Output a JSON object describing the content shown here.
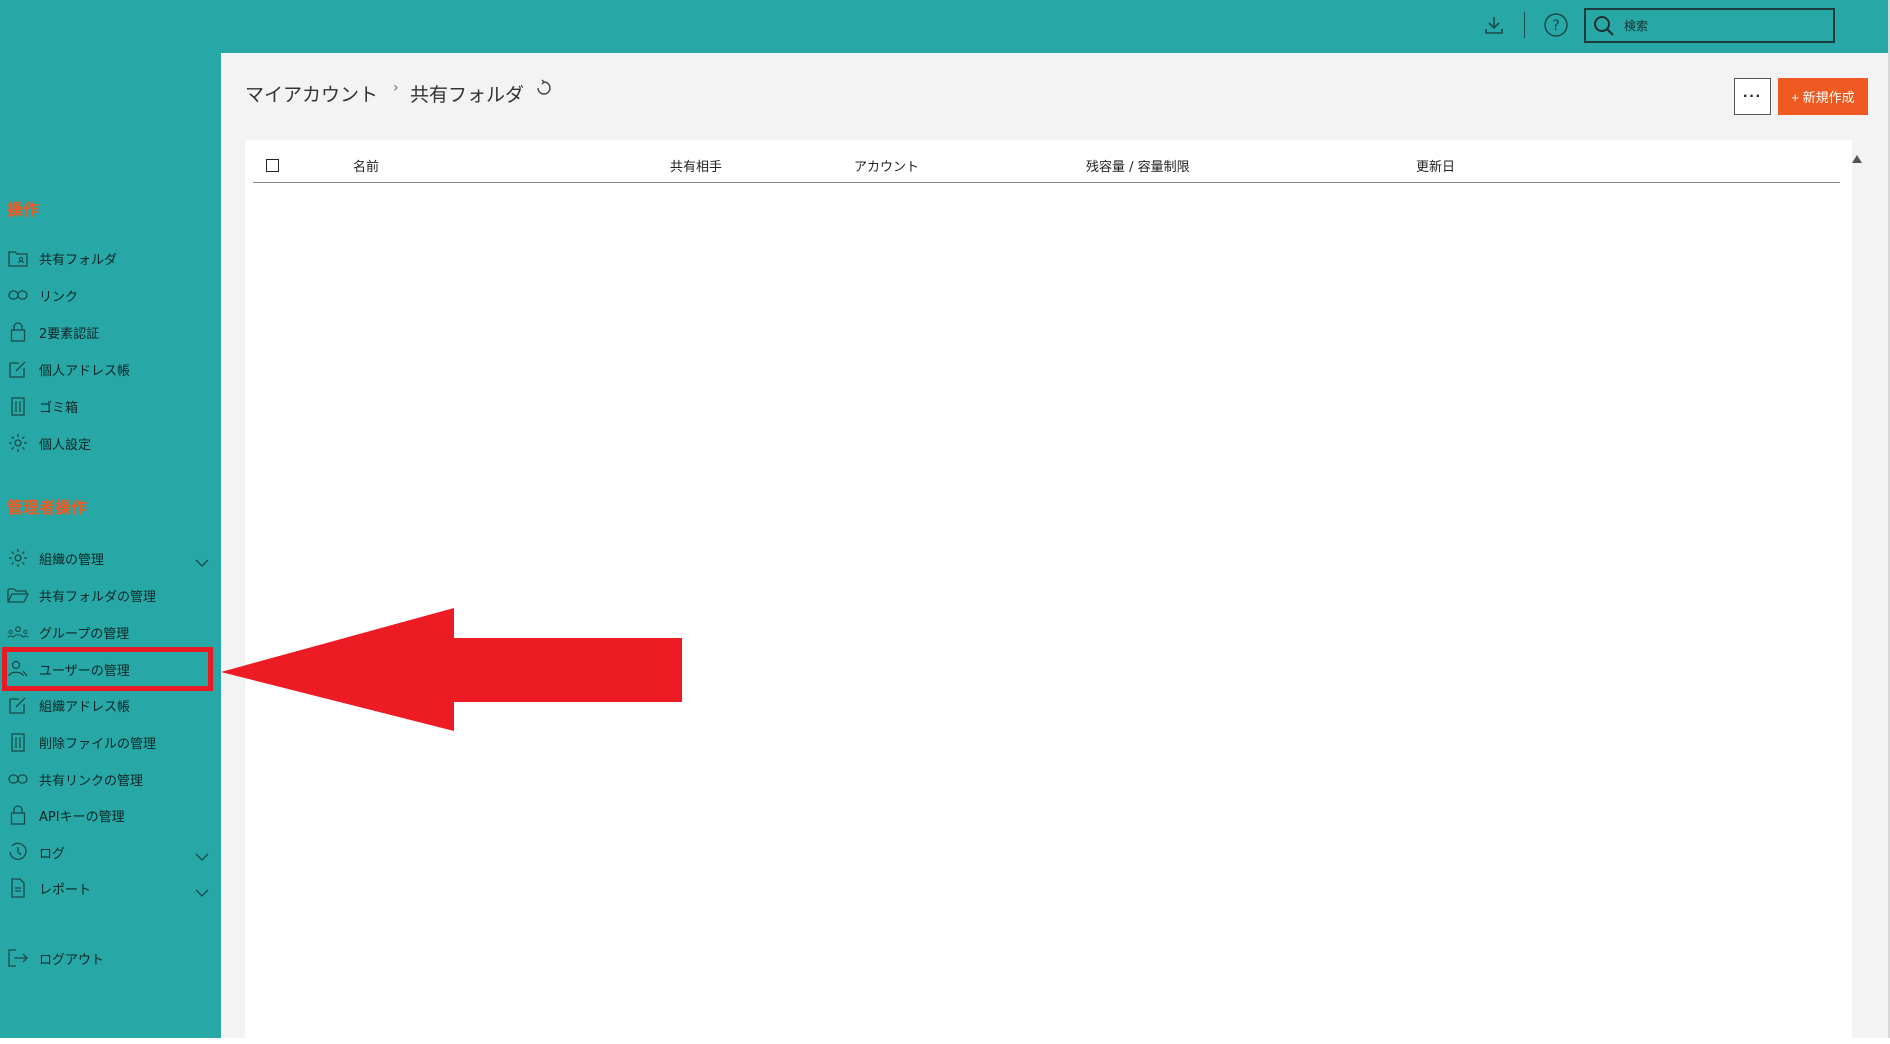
{
  "search": {
    "placeholder": "検索"
  },
  "breadcrumb": {
    "root": "マイアカウント",
    "separator": "›",
    "current": "共有フォルダ"
  },
  "toolbar": {
    "more_label": "···",
    "new_label": "+ 新規作成"
  },
  "sidebar": {
    "operations_title": "操作",
    "operations": [
      {
        "label": "共有フォルダ",
        "icon": "shared-folder-icon"
      },
      {
        "label": "リンク",
        "icon": "link-icon"
      },
      {
        "label": "2要素認証",
        "icon": "lock-icon"
      },
      {
        "label": "個人アドレス帳",
        "icon": "edit-icon"
      },
      {
        "label": "ゴミ箱",
        "icon": "trash-icon"
      },
      {
        "label": "個人設定",
        "icon": "gear-icon"
      }
    ],
    "admin_title": "管理者操作",
    "admin": [
      {
        "label": "組織の管理",
        "icon": "gear-icon",
        "expandable": true
      },
      {
        "label": "共有フォルダの管理",
        "icon": "folder-open-icon"
      },
      {
        "label": "グループの管理",
        "icon": "group-icon"
      },
      {
        "label": "ユーザーの管理",
        "icon": "user-icon"
      },
      {
        "label": "組織アドレス帳",
        "icon": "edit-icon"
      },
      {
        "label": "削除ファイルの管理",
        "icon": "trash-icon"
      },
      {
        "label": "共有リンクの管理",
        "icon": "link-icon"
      },
      {
        "label": "APIキーの管理",
        "icon": "lock-icon"
      },
      {
        "label": "ログ",
        "icon": "history-icon",
        "expandable": true
      },
      {
        "label": "レポート",
        "icon": "document-icon",
        "expandable": true
      }
    ],
    "logout": {
      "label": "ログアウト",
      "icon": "logout-icon"
    }
  },
  "table": {
    "columns": [
      "名前",
      "共有相手",
      "アカウント",
      "残容量 / 容量制限",
      "更新日"
    ],
    "rows": []
  },
  "annotation": {
    "highlighted_item": "ユーザーの管理",
    "highlight_color": "#e81b24",
    "arrow_color": "#ed1c24"
  },
  "colors": {
    "brand_teal": "#27a8a6",
    "accent_orange": "#ef5a22"
  }
}
